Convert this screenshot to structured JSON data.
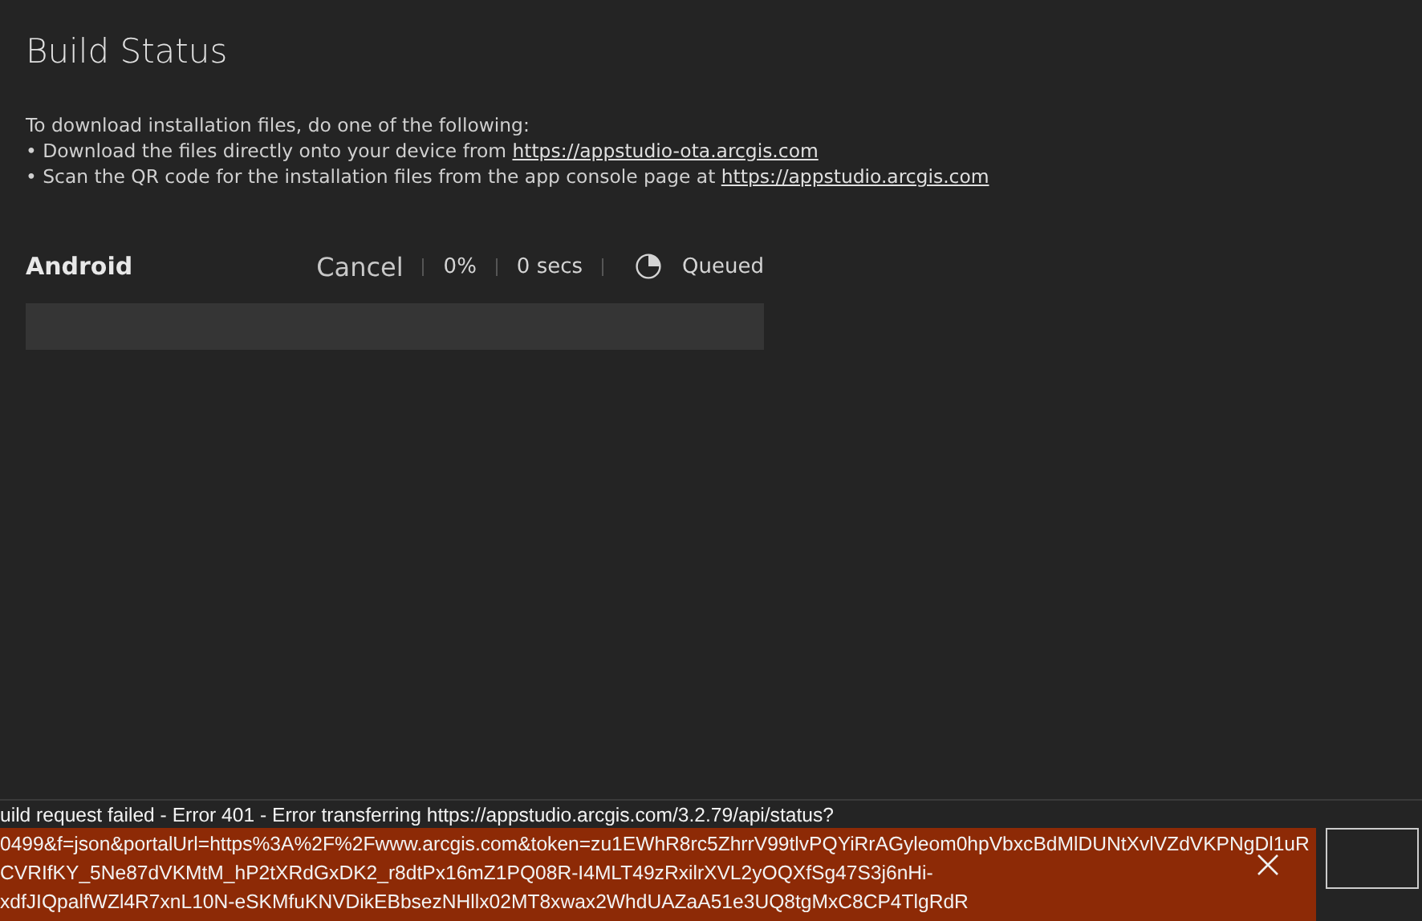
{
  "title": "Build Status",
  "instructions": {
    "intro": "To download installation files, do one of the following:",
    "bullets": [
      {
        "text": "• Download the files directly onto your device from ",
        "link": "https://appstudio-ota.arcgis.com"
      },
      {
        "text": "• Scan the QR code for the installation files from the app console page at ",
        "link": "https://appstudio.arcgis.com"
      }
    ]
  },
  "builds": [
    {
      "platform": "Android",
      "cancel": "Cancel",
      "percent": "0%",
      "duration": "0 secs",
      "status": "Queued",
      "level": 0
    }
  ],
  "error": {
    "heading": "uild request failed - Error 401 - Error transferring https://appstudio.arcgis.com/3.2.79/api/status?",
    "lines": [
      "0499&f=json&portalUrl=https%3A%2F%2Fwww.arcgis.com&token=zu1EWhR8rc5ZhrrV99tlvPQYiRrAGyleom0hpVbxcBdMlDUNtXvlVZdVKPNgDl1uR",
      "CVRIfKY_5Ne87dVKMtM_hP2tXRdGxDK2_r8dtPx16mZ1PQ08R-I4MLT49zRxilrXVL2yOQXfSg47S3j6nHi-",
      "xdfJIQpalfWZl4R7xnL10N-eSKMfuKNVDikEBbsezNHllx02MT8xwax2WhdUAZaA51e3UQ8tgMxC8CP4TlgRdR"
    ]
  }
}
